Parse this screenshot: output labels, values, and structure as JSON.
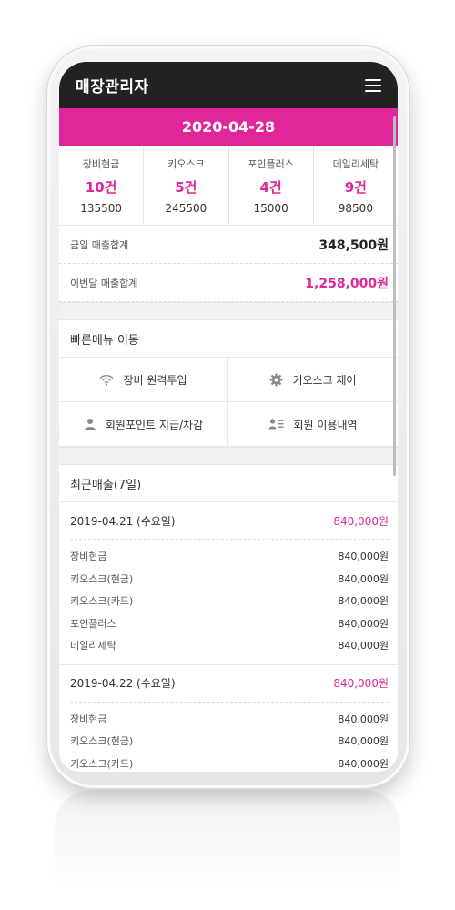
{
  "header": {
    "title": "매장관리자"
  },
  "date": "2020-04-28",
  "stats": [
    {
      "name": "장비현금",
      "count": "10건",
      "amount": "135500"
    },
    {
      "name": "키오스크",
      "count": "5건",
      "amount": "245500"
    },
    {
      "name": "포인플러스",
      "count": "4건",
      "amount": "15000"
    },
    {
      "name": "데일리세탁",
      "count": "9건",
      "amount": "98500"
    }
  ],
  "sums": {
    "today_label": "금일 매출합계",
    "today_value": "348,500원",
    "month_label": "이번달 매출합계",
    "month_value": "1,258,000원"
  },
  "quick": {
    "title": "빠른메뉴 이동",
    "items": [
      {
        "label": "장비 원격투입",
        "icon": "wifi-icon"
      },
      {
        "label": "키오스크 제어",
        "icon": "gear-icon"
      },
      {
        "label": "회원포인트 지급/차감",
        "icon": "user-icon"
      },
      {
        "label": "회원 이용내역",
        "icon": "user-list-icon"
      }
    ]
  },
  "recent": {
    "title": "최근매출(7일)",
    "days": [
      {
        "date": "2019-04.21 (수요일)",
        "total": "840,000원",
        "items": [
          {
            "name": "장비현금",
            "amount": "840,000원"
          },
          {
            "name": "키오스크(현금)",
            "amount": "840,000원"
          },
          {
            "name": "키오스크(카드)",
            "amount": "840,000원"
          },
          {
            "name": "포인플러스",
            "amount": "840,000원"
          },
          {
            "name": "데일리세탁",
            "amount": "840,000원"
          }
        ]
      },
      {
        "date": "2019-04.22 (수요일)",
        "total": "840,000원",
        "items": [
          {
            "name": "장비현금",
            "amount": "840,000원"
          },
          {
            "name": "키오스크(현금)",
            "amount": "840,000원"
          },
          {
            "name": "키오스크(카드)",
            "amount": "840,000원"
          }
        ]
      }
    ]
  },
  "colors": {
    "accent": "#e0269a",
    "header": "#222222"
  }
}
